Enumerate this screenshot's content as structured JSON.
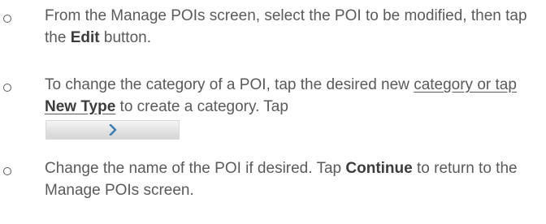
{
  "steps": [
    {
      "part1": "From the Manage POIs screen, select the POI to be modified, then tap the ",
      "bold1": "Edit",
      "part2": " button."
    },
    {
      "part1": "To change the category of a POI, tap the desired new ",
      "underlined": "category or tap ",
      "bold1": "New Type",
      "part2": " to create a category.  Tap",
      "button_icon": "chevron-right-icon"
    },
    {
      "part1": "Change the name of the POI if desired. Tap ",
      "bold1": "Continue",
      "part2": " to return to the Manage POIs screen."
    }
  ],
  "colors": {
    "text": "#5a5a5a",
    "chevron": "#3d7fb8"
  }
}
